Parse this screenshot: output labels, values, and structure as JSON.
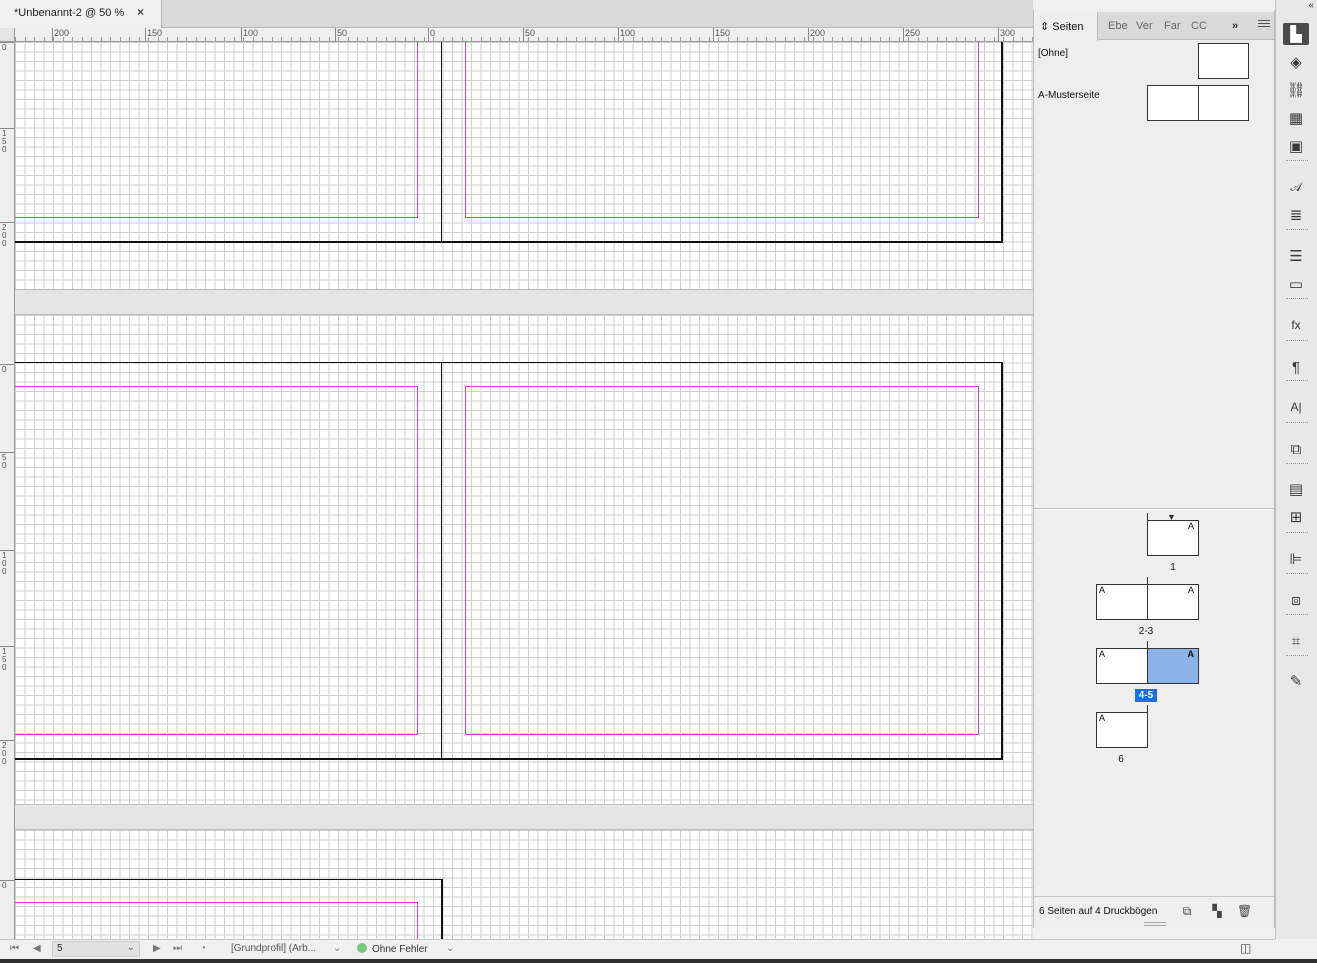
{
  "document_tab": {
    "title": "*Unbenannt-2 @ 50 %",
    "close": "×"
  },
  "ruler_top_labels": [
    "200",
    "150",
    "100",
    "50",
    "0",
    "50",
    "100",
    "150",
    "200",
    "250",
    "300"
  ],
  "ruler_left_labels": [
    "0",
    "150",
    "200",
    "0",
    "50",
    "100",
    "150",
    "200",
    "0"
  ],
  "pages_panel": {
    "tabs": [
      "Seiten",
      "Ebe",
      "Ver",
      "Far",
      "CC"
    ],
    "active_tab": "Seiten",
    "overflow": "»",
    "masters": [
      {
        "label": "[Ohne]"
      },
      {
        "label": "A-Musterseite"
      }
    ],
    "page_master_letter": "A",
    "spreads": [
      {
        "label": "1"
      },
      {
        "label": "2-3"
      },
      {
        "label": "4-5",
        "selected": true
      },
      {
        "label": "6"
      }
    ],
    "footer_info": "6 Seiten auf 4 Druckbögen",
    "selection_color": "#8cb3e8"
  },
  "tools": [
    {
      "name": "pages-tool-icon",
      "glyph": "▙",
      "active": true
    },
    {
      "name": "layers-icon",
      "glyph": "◈"
    },
    {
      "name": "links-icon",
      "glyph": "⛓"
    },
    {
      "name": "swatches-icon",
      "glyph": "▦"
    },
    {
      "name": "cc-libraries-icon",
      "glyph": "▣"
    },
    {
      "name": "character-styles-icon",
      "glyph": "𝒜"
    },
    {
      "name": "paragraph-align-icon",
      "glyph": "≣"
    },
    {
      "name": "stroke-icon",
      "glyph": "☰"
    },
    {
      "name": "gradient-icon",
      "glyph": "▭"
    },
    {
      "name": "effects-icon",
      "glyph": "fx"
    },
    {
      "name": "paragraph-icon",
      "glyph": "¶"
    },
    {
      "name": "character-icon",
      "glyph": "A|"
    },
    {
      "name": "transform-icon",
      "glyph": "⧉"
    },
    {
      "name": "table-icon",
      "glyph": "▤"
    },
    {
      "name": "table-styles-icon",
      "glyph": "⊞"
    },
    {
      "name": "align-icon",
      "glyph": "⊫"
    },
    {
      "name": "pathfinder-icon",
      "glyph": "⧈"
    },
    {
      "name": "text-wrap-icon",
      "glyph": "⌗"
    },
    {
      "name": "edit-icon",
      "glyph": "✎"
    }
  ],
  "status_bar": {
    "page_value": "5",
    "profile": "[Grundprofil] (Arb...",
    "preflight": "Ohne Fehler",
    "preflight_color": "#7ec87e"
  }
}
